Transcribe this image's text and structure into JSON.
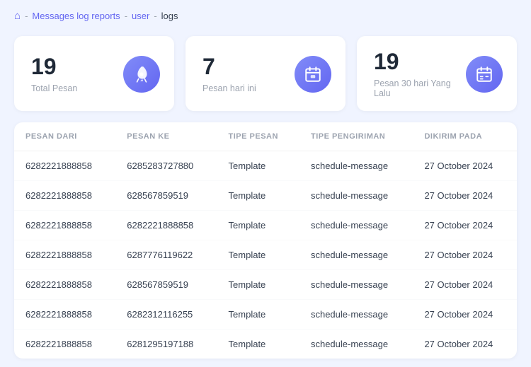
{
  "breadcrumb": {
    "home_icon": "🏠",
    "links": [
      {
        "label": "Messages log reports",
        "href": "#"
      },
      {
        "label": "user",
        "href": "#"
      },
      {
        "label": "logs",
        "href": "#"
      }
    ]
  },
  "stats": [
    {
      "number": "19",
      "label": "Total Pesan",
      "icon": "🚀"
    },
    {
      "number": "7",
      "label": "Pesan hari ini",
      "icon": "📅"
    },
    {
      "number": "19",
      "label": "Pesan 30 hari Yang Lalu",
      "icon": "📅"
    }
  ],
  "table": {
    "headers": [
      "PESAN DARI",
      "PESAN KE",
      "TIPE PESAN",
      "TIPE PENGIRIMAN",
      "DIKIRIM PADA"
    ],
    "rows": [
      {
        "pesan_dari": "6282221888858",
        "pesan_ke": "6285283727880",
        "tipe_pesan": "Template",
        "tipe_pengiriman": "schedule-message",
        "dikirim_pada": "27 October 2024"
      },
      {
        "pesan_dari": "6282221888858",
        "pesan_ke": "628567859519",
        "tipe_pesan": "Template",
        "tipe_pengiriman": "schedule-message",
        "dikirim_pada": "27 October 2024"
      },
      {
        "pesan_dari": "6282221888858",
        "pesan_ke": "6282221888858",
        "tipe_pesan": "Template",
        "tipe_pengiriman": "schedule-message",
        "dikirim_pada": "27 October 2024"
      },
      {
        "pesan_dari": "6282221888858",
        "pesan_ke": "6287776119622",
        "tipe_pesan": "Template",
        "tipe_pengiriman": "schedule-message",
        "dikirim_pada": "27 October 2024"
      },
      {
        "pesan_dari": "6282221888858",
        "pesan_ke": "628567859519",
        "tipe_pesan": "Template",
        "tipe_pengiriman": "schedule-message",
        "dikirim_pada": "27 October 2024"
      },
      {
        "pesan_dari": "6282221888858",
        "pesan_ke": "6282312116255",
        "tipe_pesan": "Template",
        "tipe_pengiriman": "schedule-message",
        "dikirim_pada": "27 October 2024"
      },
      {
        "pesan_dari": "6282221888858",
        "pesan_ke": "6281295197188",
        "tipe_pesan": "Template",
        "tipe_pengiriman": "schedule-message",
        "dikirim_pada": "27 October 2024"
      }
    ]
  }
}
